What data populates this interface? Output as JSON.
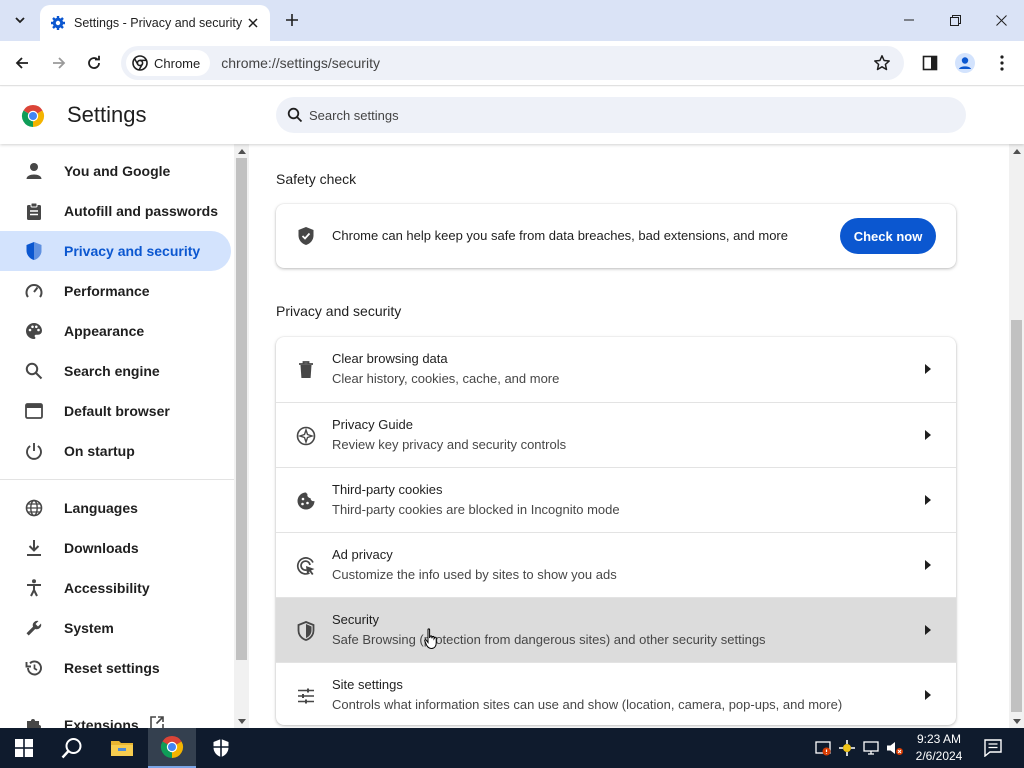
{
  "browser": {
    "tab_title": "Settings - Privacy and security",
    "chip_label": "Chrome",
    "url": "chrome://settings/security",
    "accent_color": "#0b57d0"
  },
  "settings": {
    "title": "Settings",
    "search_placeholder": "Search settings"
  },
  "sidebar": {
    "items": [
      {
        "label": "You and Google",
        "icon": "person-icon"
      },
      {
        "label": "Autofill and passwords",
        "icon": "clipboard-icon"
      },
      {
        "label": "Privacy and security",
        "icon": "shield-icon",
        "active": true
      },
      {
        "label": "Performance",
        "icon": "speedometer-icon"
      },
      {
        "label": "Appearance",
        "icon": "palette-icon"
      },
      {
        "label": "Search engine",
        "icon": "search-icon"
      },
      {
        "label": "Default browser",
        "icon": "browser-window-icon"
      },
      {
        "label": "On startup",
        "icon": "power-icon"
      },
      {
        "label": "Languages",
        "icon": "globe-icon"
      },
      {
        "label": "Downloads",
        "icon": "download-icon"
      },
      {
        "label": "Accessibility",
        "icon": "accessibility-icon"
      },
      {
        "label": "System",
        "icon": "wrench-icon"
      },
      {
        "label": "Reset settings",
        "icon": "history-icon"
      },
      {
        "label": "Extensions",
        "icon": "puzzle-icon"
      }
    ]
  },
  "main": {
    "safety_check": {
      "heading": "Safety check",
      "text": "Chrome can help keep you safe from data breaches, bad extensions, and more",
      "button": "Check now"
    },
    "privacy": {
      "heading": "Privacy and security",
      "rows": [
        {
          "title": "Clear browsing data",
          "subtitle": "Clear history, cookies, cache, and more",
          "icon": "trash-icon"
        },
        {
          "title": "Privacy Guide",
          "subtitle": "Review key privacy and security controls",
          "icon": "compass-icon"
        },
        {
          "title": "Third-party cookies",
          "subtitle": "Third-party cookies are blocked in Incognito mode",
          "icon": "cookie-icon"
        },
        {
          "title": "Ad privacy",
          "subtitle": "Customize the info used by sites to show you ads",
          "icon": "ad-privacy-icon"
        },
        {
          "title": "Security",
          "subtitle": "Safe Browsing (protection from dangerous sites) and other security settings",
          "icon": "shield-outline-icon",
          "hovered": true
        },
        {
          "title": "Site settings",
          "subtitle": "Controls what information sites can use and show (location, camera, pop-ups, and more)",
          "icon": "tune-icon"
        }
      ]
    }
  },
  "taskbar": {
    "time": "9:23 AM",
    "date": "2/6/2024"
  }
}
